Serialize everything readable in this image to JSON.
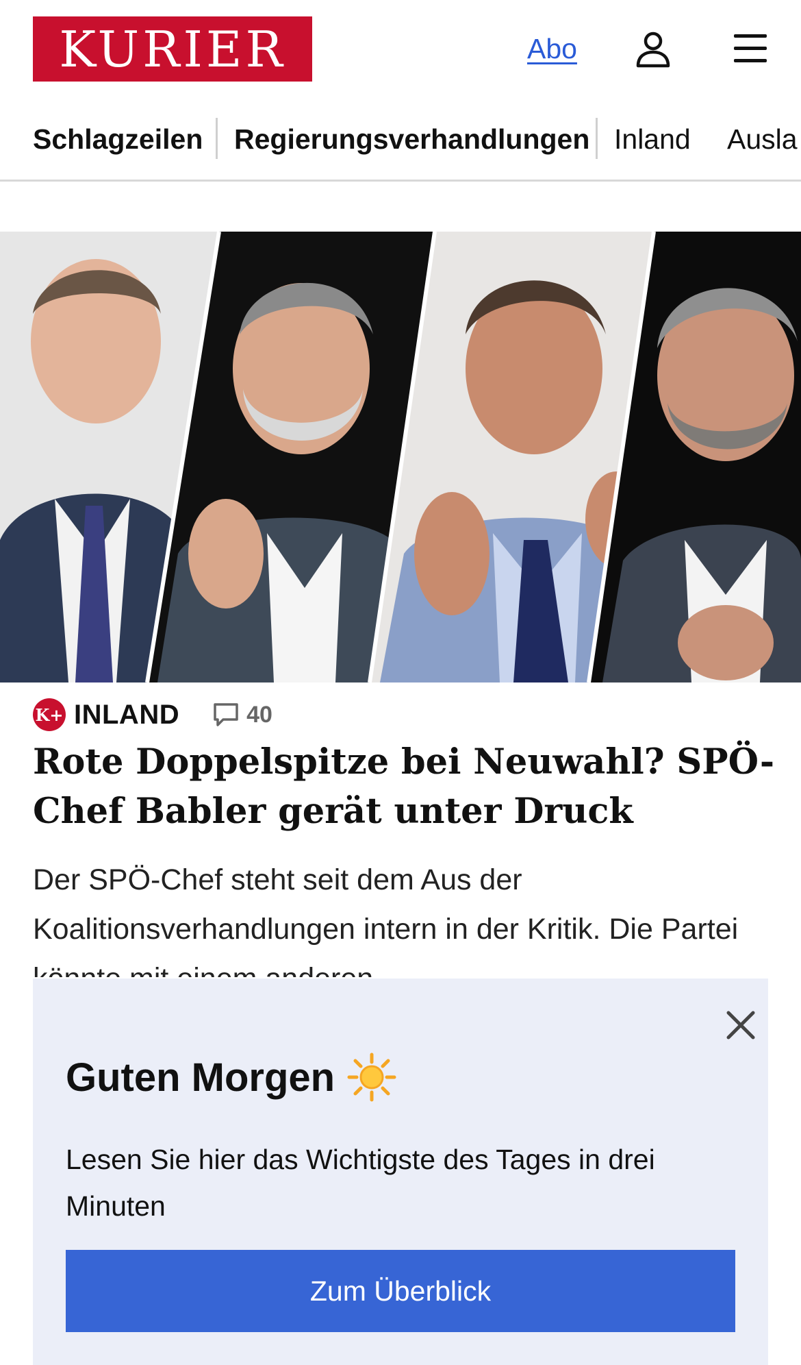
{
  "header": {
    "logo_text": "KURIER",
    "abo_label": "Abo",
    "icons": [
      "user-icon",
      "menu-icon"
    ],
    "brand_color": "#c8102e"
  },
  "nav": {
    "items": [
      {
        "label": "Schlagzeilen"
      },
      {
        "label": "Regierungsverhandlungen"
      },
      {
        "label": "Inland"
      },
      {
        "label": "Ausla"
      }
    ]
  },
  "article": {
    "badge_text": "K+",
    "section": "INLAND",
    "comment_count": "40",
    "headline": "Rote Doppelspitze bei Neuwahl? SPÖ-Chef Babler gerät unter Druck",
    "teaser": "Der SPÖ-Chef steht seit dem Aus der Koalitionsverhandlungen intern in der Kritik. Die Partei könnte mit einem anderen"
  },
  "overlay": {
    "title": "Guten Morgen",
    "icon": "sun-icon",
    "text": "Lesen Sie hier das Wichtigste des Tages in drei Minuten",
    "button_label": "Zum Überblick",
    "accent_color": "#3765d5"
  }
}
